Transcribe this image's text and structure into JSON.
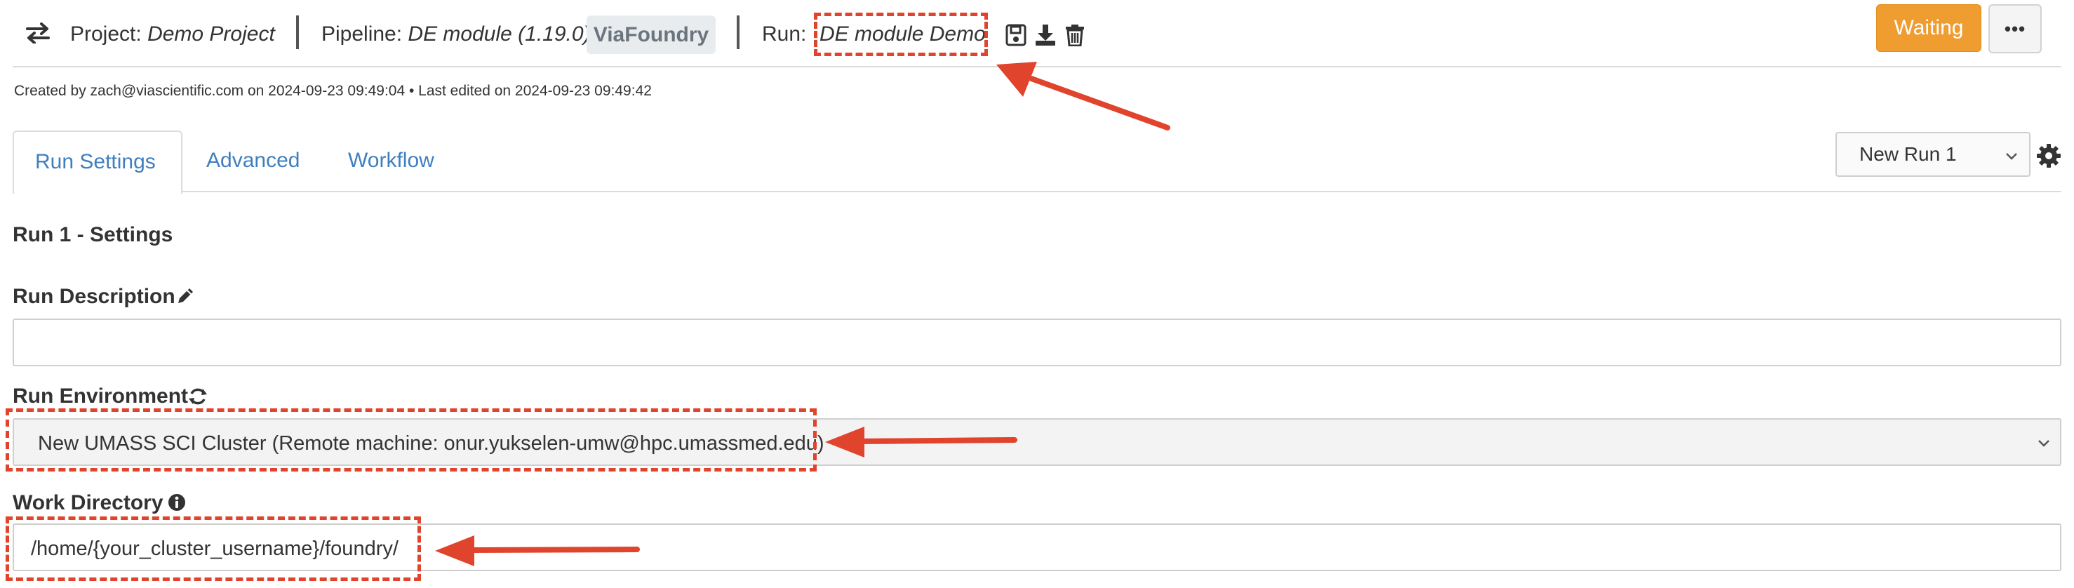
{
  "header": {
    "project_label": "Project:",
    "project_name": "Demo Project",
    "pipeline_label": "Pipeline:",
    "pipeline_name": "DE module (1.19.0)",
    "pipeline_badge": "ViaFoundry",
    "run_label": "Run:",
    "run_name": "DE module Demo",
    "status_button": "Waiting",
    "more_button": "•••",
    "meta": "Created by zach@viascientific.com on 2024-09-23 09:49:04 • Last edited on 2024-09-23 09:49:42"
  },
  "tabs": [
    {
      "label": "Run Settings",
      "active": true
    },
    {
      "label": "Advanced",
      "active": false
    },
    {
      "label": "Workflow",
      "active": false
    }
  ],
  "run_select": {
    "value": "New Run 1"
  },
  "settings": {
    "section_title": "Run 1 - Settings",
    "description_label": "Run Description",
    "description_value": "",
    "environment_label": "Run Environment",
    "environment_value": "New UMASS SCI Cluster (Remote machine: onur.yukselen-umw@hpc.umassmed.edu)",
    "workdir_label": "Work Directory",
    "workdir_value": "/home/{your_cluster_username}/foundry/"
  },
  "colors": {
    "accent": "#3f7fbf",
    "waiting": "#ef9d31",
    "annotation": "#e0442d"
  },
  "icons": [
    "swap-arrows-icon",
    "save-icon",
    "download-icon",
    "trash-icon",
    "gear-icon",
    "pencil-icon",
    "refresh-icon",
    "info-icon",
    "chevron-down-icon"
  ]
}
